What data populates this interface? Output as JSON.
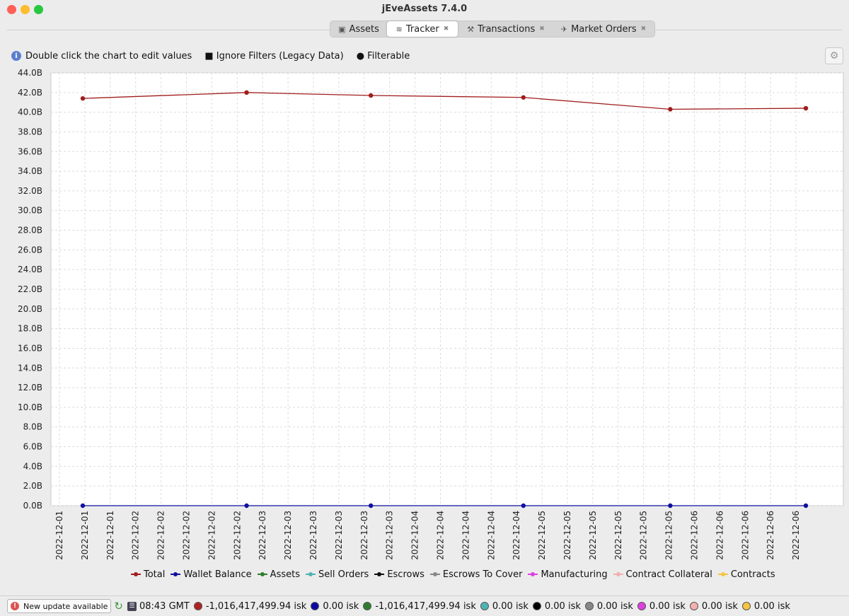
{
  "window": {
    "title": "jEveAssets 7.4.0"
  },
  "tabs": [
    {
      "label": "Assets",
      "icon": "cube-icon",
      "closable": false,
      "active": false
    },
    {
      "label": "Tracker",
      "icon": "chart-icon",
      "closable": true,
      "active": true
    },
    {
      "label": "Transactions",
      "icon": "transactions-icon",
      "closable": true,
      "active": false
    },
    {
      "label": "Market Orders",
      "icon": "market-orders-icon",
      "closable": true,
      "active": false
    }
  ],
  "toolbar": {
    "hint": "Double click the chart to edit values",
    "ignore_filters": "■ Ignore Filters (Legacy Data)",
    "filterable": "● Filterable"
  },
  "chart_data": {
    "type": "line",
    "x": [
      "2022-12-01T02:00",
      "2022-12-02T07:00",
      "2022-12-03T05:00",
      "2022-12-04T08:00",
      "2022-12-05T10:00",
      "2022-12-06T10:00"
    ],
    "x_ticks": [
      "2022-12-01",
      "2022-12-01",
      "2022-12-01",
      "2022-12-02",
      "2022-12-02",
      "2022-12-02",
      "2022-12-02",
      "2022-12-02",
      "2022-12-03",
      "2022-12-03",
      "2022-12-03",
      "2022-12-03",
      "2022-12-03",
      "2022-12-03",
      "2022-12-04",
      "2022-12-04",
      "2022-12-04",
      "2022-12-04",
      "2022-12-04",
      "2022-12-05",
      "2022-12-05",
      "2022-12-05",
      "2022-12-05",
      "2022-12-05",
      "2022-12-05",
      "2022-12-06",
      "2022-12-06",
      "2022-12-06",
      "2022-12-06",
      "2022-12-06"
    ],
    "y_ticks": [
      "0.0B",
      "2.0B",
      "4.0B",
      "6.0B",
      "8.0B",
      "10.0B",
      "12.0B",
      "14.0B",
      "16.0B",
      "18.0B",
      "20.0B",
      "22.0B",
      "24.0B",
      "26.0B",
      "28.0B",
      "30.0B",
      "32.0B",
      "34.0B",
      "36.0B",
      "38.0B",
      "40.0B",
      "42.0B",
      "44.0B"
    ],
    "ylim": [
      0,
      44
    ],
    "grid": true,
    "legend_position": "bottom",
    "series": [
      {
        "name": "Total",
        "color": "#a11d1d",
        "values": [
          41.4,
          42.0,
          41.7,
          41.5,
          40.3,
          40.4
        ]
      },
      {
        "name": "Wallet Balance",
        "color": "#1010a0",
        "values": [
          0,
          0,
          0,
          0,
          0,
          0
        ]
      },
      {
        "name": "Assets",
        "color": "#2e7d2e",
        "values": []
      },
      {
        "name": "Sell Orders",
        "color": "#4fb3b3",
        "values": []
      },
      {
        "name": "Escrows",
        "color": "#111111",
        "values": []
      },
      {
        "name": "Escrows To Cover",
        "color": "#888888",
        "values": []
      },
      {
        "name": "Manufacturing",
        "color": "#e040e0",
        "values": []
      },
      {
        "name": "Contract Collateral",
        "color": "#f4b0b0",
        "values": []
      },
      {
        "name": "Contracts",
        "color": "#f5c542",
        "values": []
      }
    ]
  },
  "status": {
    "update_label": "New update available",
    "time": "08:43 GMT",
    "values": [
      {
        "text": "-1,016,417,499.94 isk",
        "color": "#b22020"
      },
      {
        "text": "0.00 isk",
        "color": "#0a0aa0"
      },
      {
        "text": "-1,016,417,499.94 isk",
        "color": "#2e7d2e"
      },
      {
        "text": "0.00 isk",
        "color": "#4fb3b3"
      },
      {
        "text": "0.00 isk",
        "color": "#000000"
      },
      {
        "text": "0.00 isk",
        "color": "#888888"
      },
      {
        "text": "0.00 isk",
        "color": "#e040e0"
      },
      {
        "text": "0.00 isk",
        "color": "#f4b0b0"
      },
      {
        "text": "0.00 isk",
        "color": "#f5c542"
      }
    ]
  }
}
